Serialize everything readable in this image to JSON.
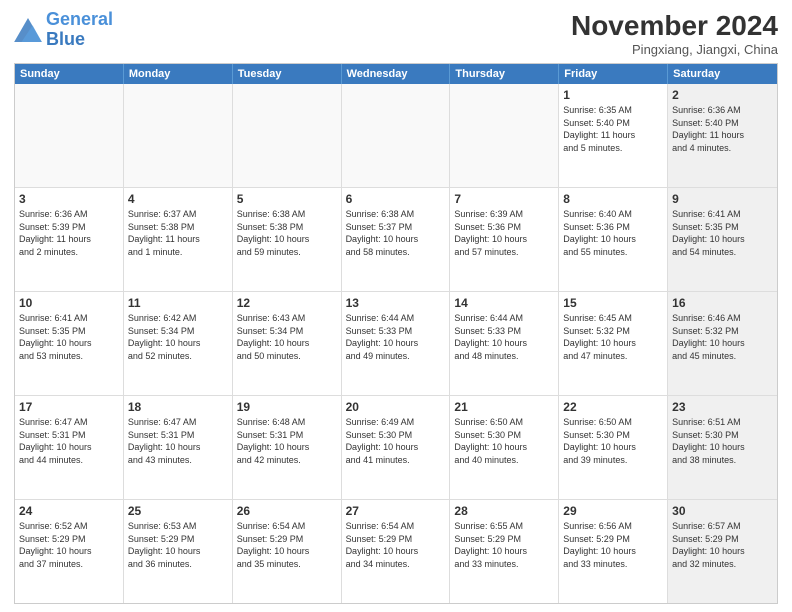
{
  "header": {
    "logo_line1": "General",
    "logo_line2": "Blue",
    "month": "November 2024",
    "location": "Pingxiang, Jiangxi, China"
  },
  "days_of_week": [
    "Sunday",
    "Monday",
    "Tuesday",
    "Wednesday",
    "Thursday",
    "Friday",
    "Saturday"
  ],
  "weeks": [
    [
      {
        "day": "",
        "info": "",
        "shaded": true
      },
      {
        "day": "",
        "info": "",
        "shaded": true
      },
      {
        "day": "",
        "info": "",
        "shaded": true
      },
      {
        "day": "",
        "info": "",
        "shaded": true
      },
      {
        "day": "",
        "info": "",
        "shaded": true
      },
      {
        "day": "1",
        "info": "Sunrise: 6:35 AM\nSunset: 5:40 PM\nDaylight: 11 hours\nand 5 minutes.",
        "shaded": false
      },
      {
        "day": "2",
        "info": "Sunrise: 6:36 AM\nSunset: 5:40 PM\nDaylight: 11 hours\nand 4 minutes.",
        "shaded": true
      }
    ],
    [
      {
        "day": "3",
        "info": "Sunrise: 6:36 AM\nSunset: 5:39 PM\nDaylight: 11 hours\nand 2 minutes.",
        "shaded": false
      },
      {
        "day": "4",
        "info": "Sunrise: 6:37 AM\nSunset: 5:38 PM\nDaylight: 11 hours\nand 1 minute.",
        "shaded": false
      },
      {
        "day": "5",
        "info": "Sunrise: 6:38 AM\nSunset: 5:38 PM\nDaylight: 10 hours\nand 59 minutes.",
        "shaded": false
      },
      {
        "day": "6",
        "info": "Sunrise: 6:38 AM\nSunset: 5:37 PM\nDaylight: 10 hours\nand 58 minutes.",
        "shaded": false
      },
      {
        "day": "7",
        "info": "Sunrise: 6:39 AM\nSunset: 5:36 PM\nDaylight: 10 hours\nand 57 minutes.",
        "shaded": false
      },
      {
        "day": "8",
        "info": "Sunrise: 6:40 AM\nSunset: 5:36 PM\nDaylight: 10 hours\nand 55 minutes.",
        "shaded": false
      },
      {
        "day": "9",
        "info": "Sunrise: 6:41 AM\nSunset: 5:35 PM\nDaylight: 10 hours\nand 54 minutes.",
        "shaded": true
      }
    ],
    [
      {
        "day": "10",
        "info": "Sunrise: 6:41 AM\nSunset: 5:35 PM\nDaylight: 10 hours\nand 53 minutes.",
        "shaded": false
      },
      {
        "day": "11",
        "info": "Sunrise: 6:42 AM\nSunset: 5:34 PM\nDaylight: 10 hours\nand 52 minutes.",
        "shaded": false
      },
      {
        "day": "12",
        "info": "Sunrise: 6:43 AM\nSunset: 5:34 PM\nDaylight: 10 hours\nand 50 minutes.",
        "shaded": false
      },
      {
        "day": "13",
        "info": "Sunrise: 6:44 AM\nSunset: 5:33 PM\nDaylight: 10 hours\nand 49 minutes.",
        "shaded": false
      },
      {
        "day": "14",
        "info": "Sunrise: 6:44 AM\nSunset: 5:33 PM\nDaylight: 10 hours\nand 48 minutes.",
        "shaded": false
      },
      {
        "day": "15",
        "info": "Sunrise: 6:45 AM\nSunset: 5:32 PM\nDaylight: 10 hours\nand 47 minutes.",
        "shaded": false
      },
      {
        "day": "16",
        "info": "Sunrise: 6:46 AM\nSunset: 5:32 PM\nDaylight: 10 hours\nand 45 minutes.",
        "shaded": true
      }
    ],
    [
      {
        "day": "17",
        "info": "Sunrise: 6:47 AM\nSunset: 5:31 PM\nDaylight: 10 hours\nand 44 minutes.",
        "shaded": false
      },
      {
        "day": "18",
        "info": "Sunrise: 6:47 AM\nSunset: 5:31 PM\nDaylight: 10 hours\nand 43 minutes.",
        "shaded": false
      },
      {
        "day": "19",
        "info": "Sunrise: 6:48 AM\nSunset: 5:31 PM\nDaylight: 10 hours\nand 42 minutes.",
        "shaded": false
      },
      {
        "day": "20",
        "info": "Sunrise: 6:49 AM\nSunset: 5:30 PM\nDaylight: 10 hours\nand 41 minutes.",
        "shaded": false
      },
      {
        "day": "21",
        "info": "Sunrise: 6:50 AM\nSunset: 5:30 PM\nDaylight: 10 hours\nand 40 minutes.",
        "shaded": false
      },
      {
        "day": "22",
        "info": "Sunrise: 6:50 AM\nSunset: 5:30 PM\nDaylight: 10 hours\nand 39 minutes.",
        "shaded": false
      },
      {
        "day": "23",
        "info": "Sunrise: 6:51 AM\nSunset: 5:30 PM\nDaylight: 10 hours\nand 38 minutes.",
        "shaded": true
      }
    ],
    [
      {
        "day": "24",
        "info": "Sunrise: 6:52 AM\nSunset: 5:29 PM\nDaylight: 10 hours\nand 37 minutes.",
        "shaded": false
      },
      {
        "day": "25",
        "info": "Sunrise: 6:53 AM\nSunset: 5:29 PM\nDaylight: 10 hours\nand 36 minutes.",
        "shaded": false
      },
      {
        "day": "26",
        "info": "Sunrise: 6:54 AM\nSunset: 5:29 PM\nDaylight: 10 hours\nand 35 minutes.",
        "shaded": false
      },
      {
        "day": "27",
        "info": "Sunrise: 6:54 AM\nSunset: 5:29 PM\nDaylight: 10 hours\nand 34 minutes.",
        "shaded": false
      },
      {
        "day": "28",
        "info": "Sunrise: 6:55 AM\nSunset: 5:29 PM\nDaylight: 10 hours\nand 33 minutes.",
        "shaded": false
      },
      {
        "day": "29",
        "info": "Sunrise: 6:56 AM\nSunset: 5:29 PM\nDaylight: 10 hours\nand 33 minutes.",
        "shaded": false
      },
      {
        "day": "30",
        "info": "Sunrise: 6:57 AM\nSunset: 5:29 PM\nDaylight: 10 hours\nand 32 minutes.",
        "shaded": true
      }
    ]
  ]
}
